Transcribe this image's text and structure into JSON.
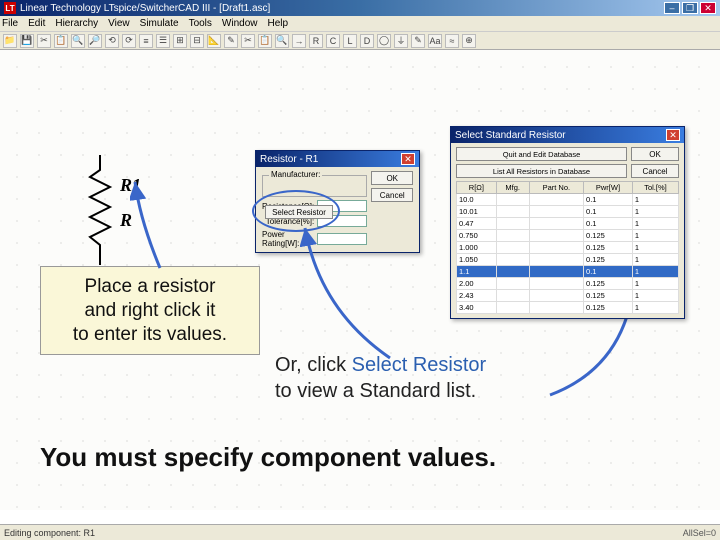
{
  "window": {
    "title": "Linear Technology LTspice/SwitcherCAD III - [Draft1.asc]",
    "iconText": "LT"
  },
  "menubar": [
    "File",
    "Edit",
    "Hierarchy",
    "View",
    "Simulate",
    "Tools",
    "Window",
    "Help"
  ],
  "toolbar_icons": [
    "📁",
    "💾",
    "✂",
    "📋",
    "🔍",
    "🔎",
    "⟲",
    "⟳",
    "≡",
    "☰",
    "⊞",
    "⊟",
    "📐",
    "✎",
    "✂",
    "📋",
    "🔍",
    "→",
    "R",
    "C",
    "L",
    "D",
    "◯",
    "⏚",
    "✎",
    "Aa",
    "≈",
    "⊕"
  ],
  "resistor": {
    "ref": "R1",
    "value": "R"
  },
  "callout1": {
    "line1": "Place a resistor",
    "line2": "and right click it",
    "line3": "to enter its values."
  },
  "callout2": {
    "prefix": "Or, click ",
    "link": "Select Resistor",
    "line2": "to view a Standard list."
  },
  "main_message": "You must specify component values.",
  "dlg_resistor": {
    "title": "Resistor - R1",
    "group": "Manufacturer:",
    "select_btn": "Select Resistor",
    "ok": "OK",
    "cancel": "Cancel",
    "fields": {
      "resistance_label": "Resistance[Ω]:",
      "resistance_val": "",
      "tolerance_label": "Tolerance[%]:",
      "tolerance_val": "",
      "power_label": "Power Rating[W]:",
      "power_val": ""
    }
  },
  "dlg_standard": {
    "title": "Select Standard Resistor",
    "btn_quit": "Quit and Edit Database",
    "btn_ok": "OK",
    "btn_list": "List All Resistors in Database",
    "btn_cancel": "Cancel",
    "headers": [
      "R[Ω]",
      "Mfg.",
      "Part No.",
      "Pwr[W]",
      "Tol.[%]"
    ],
    "rows": [
      [
        "10.0",
        "",
        "",
        "0.1",
        "1"
      ],
      [
        "10.01",
        "",
        "",
        "0.1",
        "1"
      ],
      [
        "0.47",
        "",
        "",
        "0.1",
        "1"
      ],
      [
        "0.750",
        "",
        "",
        "0.125",
        "1"
      ],
      [
        "1.000",
        "",
        "",
        "0.125",
        "1"
      ],
      [
        "1.050",
        "",
        "",
        "0.125",
        "1"
      ],
      [
        "1.1",
        "",
        "",
        "0.1",
        "1"
      ],
      [
        "2.00",
        "",
        "",
        "0.125",
        "1"
      ],
      [
        "2.43",
        "",
        "",
        "0.125",
        "1"
      ],
      [
        "3.40",
        "",
        "",
        "0.125",
        "1"
      ]
    ],
    "selected_row": 6
  },
  "statusbar": {
    "left": "Editing component: R1",
    "right": "AllSel=0"
  }
}
